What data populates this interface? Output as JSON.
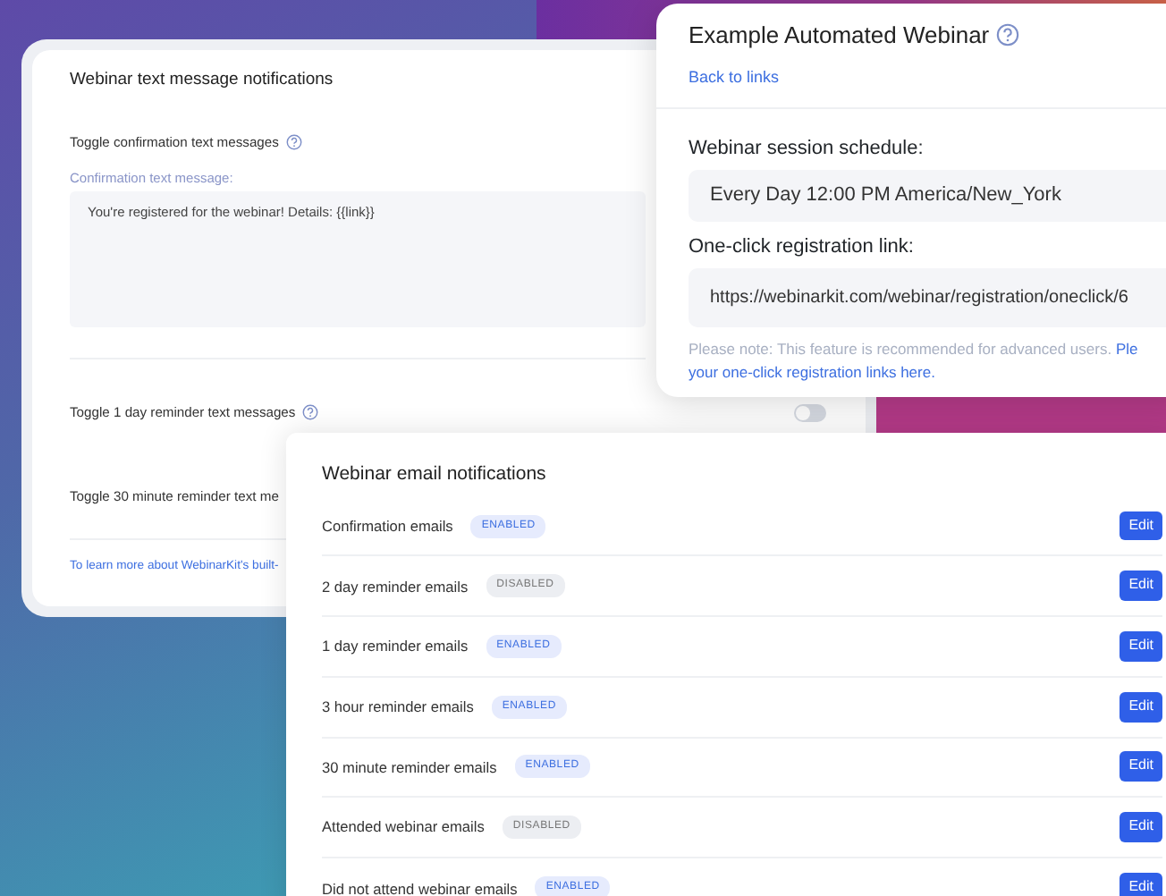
{
  "text_notifications": {
    "title": "Webinar text message notifications",
    "settings": [
      {
        "label": "Toggle confirmation text messages",
        "help": true,
        "message_label": "Confirmation text message:",
        "message": "You're registered for the webinar! Details: {{link}}"
      },
      {
        "label": "Toggle 1 day reminder text messages",
        "help": true,
        "on": false
      },
      {
        "label": "Toggle 30 minute reminder text me",
        "help": false
      }
    ],
    "footer_link": "To learn more about WebinarKit's built-"
  },
  "webinar_panel": {
    "title": "Example Automated Webinar",
    "help": true,
    "back_link": "Back to links",
    "schedule_label": "Webinar session schedule:",
    "schedule": "Every Day 12:00 PM America/New_York",
    "link_label": "One-click registration link:",
    "link": "https://webinarkit.com/webinar/registration/oneclick/6",
    "note": "Please note: This feature is recommended for advanced users.",
    "note_links": [
      "Ple",
      "your one-click registration links here."
    ]
  },
  "email_notifications": {
    "title": "Webinar email notifications",
    "rows": [
      {
        "label": "Confirmation emails",
        "status": "ENABLED",
        "enabled": true,
        "button": "Edit"
      },
      {
        "label": "2 day reminder emails",
        "status": "DISABLED",
        "enabled": false,
        "button": "Edit"
      },
      {
        "label": "1 day reminder emails",
        "status": "ENABLED",
        "enabled": true,
        "button": "Edit"
      },
      {
        "label": "3 hour reminder emails",
        "status": "ENABLED",
        "enabled": true,
        "button": "Edit"
      },
      {
        "label": "30 minute reminder emails",
        "status": "ENABLED",
        "enabled": true,
        "button": "Edit"
      },
      {
        "label": "Attended webinar emails",
        "status": "DISABLED",
        "enabled": false,
        "button": "Edit"
      },
      {
        "label": "Did not attend webinar emails",
        "status": "ENABLED",
        "enabled": true,
        "button": "Edit"
      }
    ]
  }
}
